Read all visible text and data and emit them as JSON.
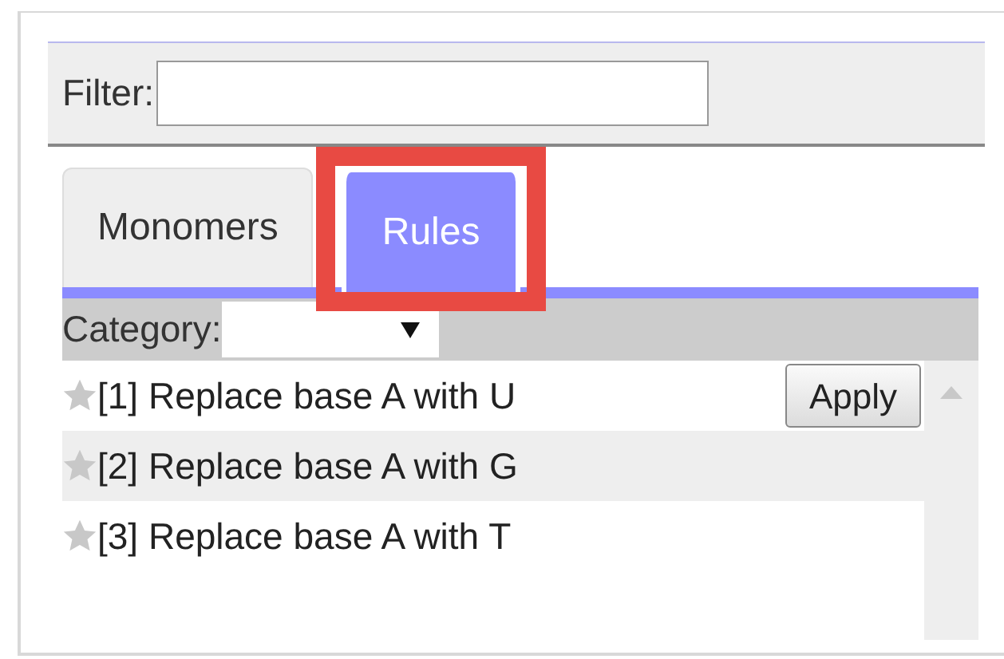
{
  "filter": {
    "label": "Filter:"
  },
  "tabs": [
    {
      "label": "Monomers",
      "selected": false,
      "highlighted": false
    },
    {
      "label": "Rules",
      "selected": true,
      "highlighted": true
    }
  ],
  "category": {
    "label": "Category:"
  },
  "rules": [
    {
      "text": "[1] Replace base A with U",
      "starred": false,
      "hovered": false,
      "action": "Apply"
    },
    {
      "text": "[2] Replace base A with G",
      "starred": false,
      "hovered": true
    },
    {
      "text": "[3] Replace base A with T",
      "starred": false,
      "hovered": false
    }
  ]
}
